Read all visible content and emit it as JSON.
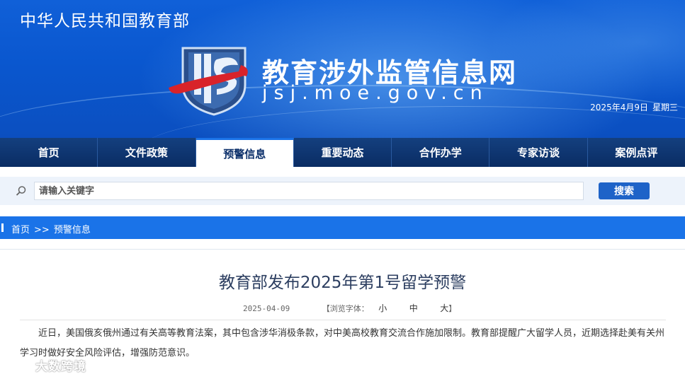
{
  "header": {
    "ministry": "中华人民共和国教育部",
    "site_title": "教育涉外监管信息网",
    "site_domain": "jsj.moe.gov.cn",
    "date": "2025年4月9日",
    "weekday": "星期三"
  },
  "nav": {
    "items": [
      "首页",
      "文件政策",
      "预警信息",
      "重要动态",
      "合作办学",
      "专家访谈",
      "案例点评"
    ],
    "active": "预警信息"
  },
  "search": {
    "placeholder": "请输入关键字",
    "button": "搜索"
  },
  "breadcrumb": {
    "home": "首页",
    "separator": ">>",
    "current": "预警信息"
  },
  "article": {
    "title": "教育部发布2025年第1号留学预警",
    "date": "2025-04-09",
    "font_label_open": "【浏览字体：",
    "font_sizes": [
      "小",
      "中",
      "大"
    ],
    "font_label_close": "】",
    "body": "近日，美国俄亥俄州通过有关高等教育法案，其中包含涉华消极条款，对中美高校教育交流合作施加限制。教育部提醒广大留学人员，近期选择赴美有关州学习时做好安全风险评估，增强防范意识。"
  },
  "watermark": "大数跨境",
  "colors": {
    "banner_blue": "#0a57cf",
    "nav_navy": "#0b2f6a",
    "breadcrumb_blue": "#1a73e8",
    "search_button": "#1e63c8",
    "logo_red": "#d8232a"
  },
  "icons": {
    "search": "search-icon",
    "logo": "jsj-logo-icon"
  }
}
